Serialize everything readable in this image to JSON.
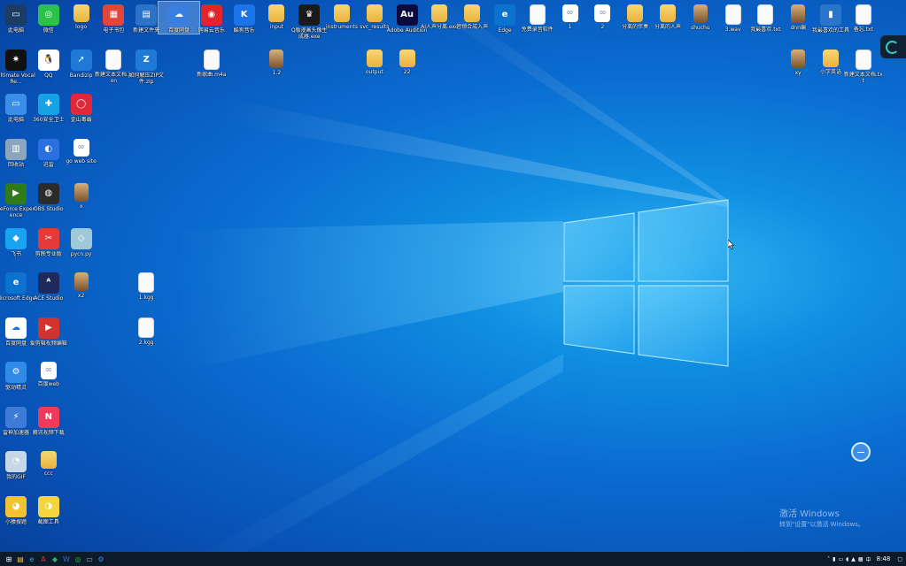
{
  "desktop": {
    "icons": [
      {
        "label": "此电脑",
        "kind": "app",
        "color": "#1d3c64",
        "glyph": "▭",
        "col": 0,
        "row": 0
      },
      {
        "label": "微信",
        "kind": "app",
        "color": "#2cc14a",
        "glyph": "◎",
        "col": 1,
        "row": 0
      },
      {
        "label": "logo",
        "kind": "folder",
        "col": 2,
        "row": 0
      },
      {
        "label": "电子书包",
        "kind": "app",
        "color": "#e0463a",
        "glyph": "▦",
        "col": 3,
        "row": 0
      },
      {
        "label": "新建文件夹",
        "kind": "app",
        "color": "#2b72c8",
        "glyph": "▤",
        "col": 4,
        "row": 0
      },
      {
        "label": "百度网盘",
        "kind": "app",
        "color": "#3a7fe0",
        "glyph": "☁",
        "col": 5,
        "row": 0,
        "selected": true
      },
      {
        "label": "网易云音乐",
        "kind": "app",
        "color": "#e0262b",
        "glyph": "◉",
        "col": 6,
        "row": 0
      },
      {
        "label": "酷狗音乐",
        "kind": "app",
        "color": "#1b73e8",
        "glyph": "K",
        "col": 7,
        "row": 0
      },
      {
        "label": "input",
        "kind": "folder",
        "col": 8,
        "row": 0
      },
      {
        "label": "Q版漫画头像生成器.exe",
        "kind": "app",
        "color": "#1a1a1a",
        "glyph": "♛",
        "col": 9,
        "row": 0
      },
      {
        "label": "instruments",
        "kind": "folder",
        "col": 10,
        "row": 0
      },
      {
        "label": "svc_results",
        "kind": "folder",
        "col": 11,
        "row": 0
      },
      {
        "label": "Adobe Audition",
        "kind": "app",
        "color": "#0a0a3c",
        "glyph": "Au",
        "col": 12,
        "row": 0
      },
      {
        "label": "AI人声分离.exe",
        "kind": "folder",
        "col": 13,
        "row": 0
      },
      {
        "label": "音频合成入声",
        "kind": "folder",
        "col": 14,
        "row": 0
      },
      {
        "label": "Edge",
        "kind": "app",
        "color": "#0b72cf",
        "glyph": "e",
        "col": 15,
        "row": 0
      },
      {
        "label": "免费录音软件",
        "kind": "file",
        "col": 16,
        "row": 0
      },
      {
        "label": "1",
        "kind": "web",
        "col": 17,
        "row": 0
      },
      {
        "label": "2",
        "kind": "web",
        "col": 18,
        "row": 0
      },
      {
        "label": "分离的伴奏",
        "kind": "folder",
        "col": 19,
        "row": 0
      },
      {
        "label": "分离的人声",
        "kind": "folder",
        "col": 20,
        "row": 0
      },
      {
        "label": "shuchu",
        "kind": "photo",
        "col": 21,
        "row": 0
      },
      {
        "label": "3.wav",
        "kind": "file",
        "col": 22,
        "row": 0
      },
      {
        "label": "我最喜欢.txt",
        "kind": "file",
        "col": 23,
        "row": 0
      },
      {
        "label": "dnn编",
        "kind": "photo",
        "col": 24,
        "row": 0
      },
      {
        "label": "我最喜欢的工具",
        "kind": "app",
        "color": "#2a74c9",
        "glyph": "▮",
        "col": 25,
        "row": 0
      },
      {
        "label": "备忘.txt",
        "kind": "file",
        "col": 26,
        "row": 0
      },
      {
        "label": "Ultimate Vocal Re...",
        "kind": "app",
        "color": "#111",
        "glyph": "✷",
        "col": 0,
        "row": 1
      },
      {
        "label": "QQ",
        "kind": "app",
        "color": "#ffffff",
        "glyph": "🐧",
        "col": 1,
        "row": 1
      },
      {
        "label": "Bandizip",
        "kind": "app",
        "color": "#1e7ad4",
        "glyph": "➚",
        "col": 2,
        "row": 1
      },
      {
        "label": "新建文本文档.json",
        "kind": "file",
        "col": 3,
        "row": 1
      },
      {
        "label": "如何解压ZIP文件.zip",
        "kind": "app",
        "color": "#1e7ad4",
        "glyph": "Z",
        "col": 4,
        "row": 1
      },
      {
        "label": "新歌曲.m4a",
        "kind": "file",
        "col": 6,
        "row": 1
      },
      {
        "label": "1.2",
        "kind": "photo",
        "col": 8,
        "row": 1
      },
      {
        "label": "output",
        "kind": "folder",
        "col": 11,
        "row": 1
      },
      {
        "label": "22",
        "kind": "folder",
        "col": 12,
        "row": 1
      },
      {
        "label": "xy",
        "kind": "photo",
        "col": 24,
        "row": 1
      },
      {
        "label": "小学英语",
        "kind": "folder",
        "col": 25,
        "row": 1
      },
      {
        "label": "新建文本文档.txt",
        "kind": "file",
        "col": 26,
        "row": 1
      },
      {
        "label": "此电脑",
        "kind": "app",
        "color": "#3b8ee8",
        "glyph": "▭",
        "col": 0,
        "row": 2
      },
      {
        "label": "360安全卫士",
        "kind": "app",
        "color": "#17a2e6",
        "glyph": "✚",
        "col": 1,
        "row": 2
      },
      {
        "label": "金山毒霸",
        "kind": "app",
        "color": "#e22838",
        "glyph": "◯",
        "col": 2,
        "row": 2
      },
      {
        "label": "回收站",
        "kind": "app",
        "color": "#8ba6bc",
        "glyph": "▥",
        "col": 0,
        "row": 3
      },
      {
        "label": "迅雷",
        "kind": "app",
        "color": "#2b70e0",
        "glyph": "◐",
        "col": 1,
        "row": 3
      },
      {
        "label": "go web site",
        "kind": "web",
        "col": 2,
        "row": 3
      },
      {
        "label": "GeForce Experience",
        "kind": "app",
        "color": "#2f7a19",
        "glyph": "▶",
        "col": 0,
        "row": 4
      },
      {
        "label": "OBS Studio",
        "kind": "app",
        "color": "#2b2b2b",
        "glyph": "◍",
        "col": 1,
        "row": 4
      },
      {
        "label": "x",
        "kind": "photo",
        "col": 2,
        "row": 4
      },
      {
        "label": "飞书",
        "kind": "app",
        "color": "#19a3f0",
        "glyph": "◆",
        "col": 0,
        "row": 5
      },
      {
        "label": "剪映专业版",
        "kind": "app",
        "color": "#e43a3a",
        "glyph": "✂",
        "col": 1,
        "row": 5
      },
      {
        "label": "pycn.py",
        "kind": "app",
        "color": "#9fc8d8",
        "glyph": "◇",
        "col": 2,
        "row": 5
      },
      {
        "label": "Microsoft Edge",
        "kind": "app",
        "color": "#0b72cf",
        "glyph": "e",
        "col": 0,
        "row": 6
      },
      {
        "label": "ACE Studio",
        "kind": "app",
        "color": "#1f2a5c",
        "glyph": "ᴬ",
        "col": 1,
        "row": 6
      },
      {
        "label": "x2",
        "kind": "photo",
        "col": 2,
        "row": 6
      },
      {
        "label": "1.kgg",
        "kind": "file",
        "col": 4,
        "row": 6
      },
      {
        "label": "百度网盘",
        "kind": "app",
        "color": "#ffffff",
        "glyph": "☁",
        "col": 0,
        "row": 7
      },
      {
        "label": "爱剪辑视频编辑",
        "kind": "app",
        "color": "#d4322c",
        "glyph": "▶",
        "col": 1,
        "row": 7
      },
      {
        "label": "2.kgg",
        "kind": "file",
        "col": 4,
        "row": 7
      },
      {
        "label": "驱动精灵",
        "kind": "app",
        "color": "#2f8ae8",
        "glyph": "⚙",
        "col": 0,
        "row": 8
      },
      {
        "label": "百度web",
        "kind": "web",
        "col": 1,
        "row": 8
      },
      {
        "label": "雷神加速器",
        "kind": "app",
        "color": "#3f7bd6",
        "glyph": "⚡",
        "col": 0,
        "row": 9
      },
      {
        "label": "腾讯视频下载",
        "kind": "app",
        "color": "#f03a5b",
        "glyph": "N",
        "col": 1,
        "row": 9
      },
      {
        "label": "我的GIF",
        "kind": "app",
        "color": "#c7d7e6",
        "glyph": "◔",
        "col": 0,
        "row": 10
      },
      {
        "label": "ccc",
        "kind": "folder",
        "col": 1,
        "row": 10
      },
      {
        "label": "小猿搜题",
        "kind": "app",
        "color": "#f3c233",
        "glyph": "◕",
        "col": 0,
        "row": 11
      },
      {
        "label": "截图工具",
        "kind": "app",
        "color": "#f5d442",
        "glyph": "◑",
        "col": 1,
        "row": 11
      }
    ]
  },
  "watermark": {
    "line1": "激活 Windows",
    "line2": "转到\"设置\"以激活 Windows。"
  },
  "taskbar": {
    "apps": [
      {
        "name": "start-button",
        "glyph": "⊞",
        "color": "#ffffff"
      },
      {
        "name": "file-explorer",
        "glyph": "▤",
        "color": "#f3c243"
      },
      {
        "name": "edge-browser",
        "glyph": "e",
        "color": "#2aa3f0"
      },
      {
        "name": "adobe-app",
        "glyph": "A",
        "color": "#e2322f"
      },
      {
        "name": "photos-app",
        "glyph": "◆",
        "color": "#3aa86b"
      },
      {
        "name": "word-app",
        "glyph": "W",
        "color": "#2b6fd6"
      },
      {
        "name": "wechat-app",
        "glyph": "◎",
        "color": "#2cc14a"
      },
      {
        "name": "terminal-app",
        "glyph": "▭",
        "color": "#9ab4cc"
      },
      {
        "name": "settings-app",
        "glyph": "⚙",
        "color": "#3a87e6"
      }
    ],
    "tray": {
      "icons": [
        "chevron-up-icon",
        "microphone-icon",
        "display-icon",
        "speaker-icon",
        "network-icon",
        "keyboard-icon",
        "ime-icon"
      ],
      "time": "8:48"
    }
  }
}
